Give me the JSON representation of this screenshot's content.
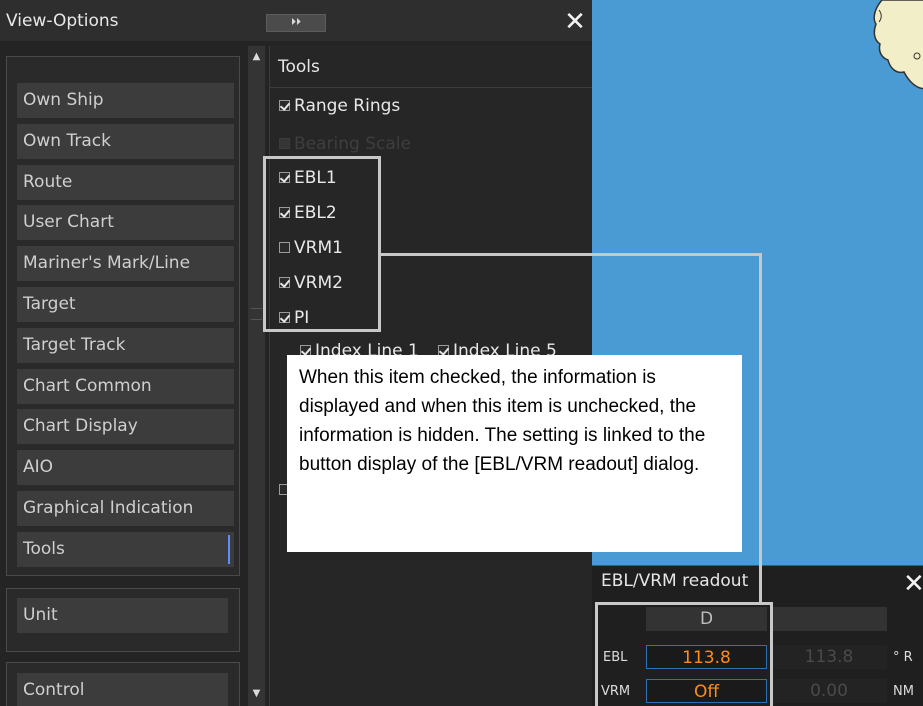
{
  "window": {
    "title": "View-Options",
    "expand_glyph": "⏵⏵",
    "close_glyph": "✕"
  },
  "menu": {
    "items": [
      {
        "label": "Own Ship"
      },
      {
        "label": "Own Track"
      },
      {
        "label": "Route"
      },
      {
        "label": "User Chart"
      },
      {
        "label": "Mariner's Mark/Line"
      },
      {
        "label": "Target"
      },
      {
        "label": "Target Track"
      },
      {
        "label": "Chart Common"
      },
      {
        "label": "Chart Display"
      },
      {
        "label": "AIO"
      },
      {
        "label": "Graphical Indication"
      },
      {
        "label": "Tools",
        "selected": true
      }
    ],
    "unit_label": "Unit",
    "control_label": "Control"
  },
  "scroll": {
    "up_glyph": "▲",
    "down_glyph": "▼"
  },
  "tools": {
    "title": "Tools",
    "options": [
      {
        "label": "Range Rings",
        "checked": true,
        "enabled": true
      },
      {
        "label": "Bearing Scale",
        "checked": false,
        "enabled": false
      },
      {
        "label": "EBL1",
        "checked": true,
        "enabled": true
      },
      {
        "label": "EBL2",
        "checked": true,
        "enabled": true
      },
      {
        "label": "VRM1",
        "checked": false,
        "enabled": true
      },
      {
        "label": "VRM2",
        "checked": true,
        "enabled": true
      },
      {
        "label": "PI",
        "checked": true,
        "enabled": true
      }
    ],
    "pi_sub": [
      {
        "label": "Index Line 1",
        "checked": true
      },
      {
        "label": "Index Line 5",
        "checked": true
      }
    ]
  },
  "callout": {
    "text": "When this item checked, the information is displayed and when this item is unchecked, the information is hidden. The setting is linked to the button display of the [EBL/VRM readout] dialog."
  },
  "readout": {
    "title": "EBL/VRM readout",
    "close_glyph": "✕",
    "column_header": "D",
    "rows": [
      {
        "label": "EBL",
        "value": "113.8",
        "dim_value": "113.8",
        "unit": "° R"
      },
      {
        "label": "VRM",
        "value": "Off",
        "dim_value": "0.00",
        "unit": "NM"
      }
    ]
  },
  "colors": {
    "accent_blue": "#5a8dff",
    "readout_orange": "#ff8c1a",
    "sea_blue": "#4a9bd3",
    "highlight_gray": "#c8c8c8"
  }
}
